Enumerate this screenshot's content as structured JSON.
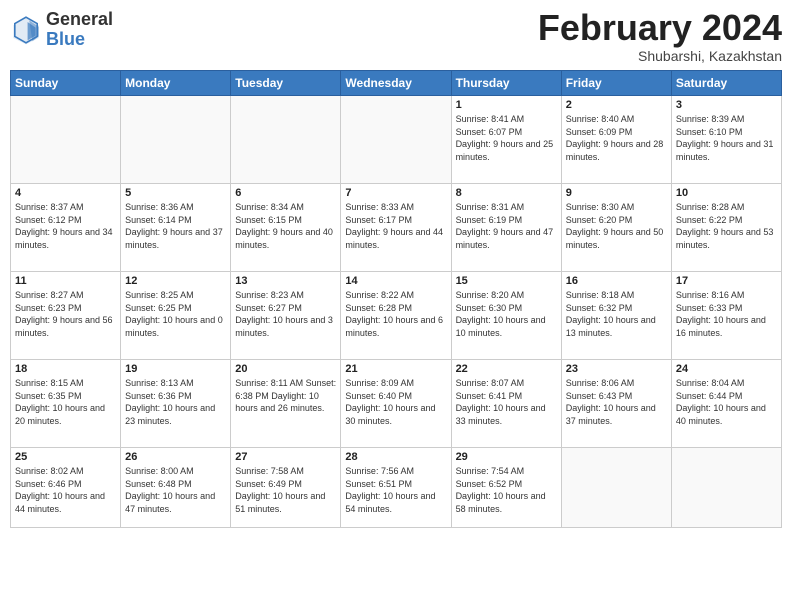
{
  "logo": {
    "line1": "General",
    "line2": "Blue"
  },
  "header": {
    "month": "February 2024",
    "location": "Shubarshi, Kazakhstan"
  },
  "days_of_week": [
    "Sunday",
    "Monday",
    "Tuesday",
    "Wednesday",
    "Thursday",
    "Friday",
    "Saturday"
  ],
  "weeks": [
    [
      {
        "day": "",
        "info": ""
      },
      {
        "day": "",
        "info": ""
      },
      {
        "day": "",
        "info": ""
      },
      {
        "day": "",
        "info": ""
      },
      {
        "day": "1",
        "info": "Sunrise: 8:41 AM\nSunset: 6:07 PM\nDaylight: 9 hours and 25 minutes."
      },
      {
        "day": "2",
        "info": "Sunrise: 8:40 AM\nSunset: 6:09 PM\nDaylight: 9 hours and 28 minutes."
      },
      {
        "day": "3",
        "info": "Sunrise: 8:39 AM\nSunset: 6:10 PM\nDaylight: 9 hours and 31 minutes."
      }
    ],
    [
      {
        "day": "4",
        "info": "Sunrise: 8:37 AM\nSunset: 6:12 PM\nDaylight: 9 hours and 34 minutes."
      },
      {
        "day": "5",
        "info": "Sunrise: 8:36 AM\nSunset: 6:14 PM\nDaylight: 9 hours and 37 minutes."
      },
      {
        "day": "6",
        "info": "Sunrise: 8:34 AM\nSunset: 6:15 PM\nDaylight: 9 hours and 40 minutes."
      },
      {
        "day": "7",
        "info": "Sunrise: 8:33 AM\nSunset: 6:17 PM\nDaylight: 9 hours and 44 minutes."
      },
      {
        "day": "8",
        "info": "Sunrise: 8:31 AM\nSunset: 6:19 PM\nDaylight: 9 hours and 47 minutes."
      },
      {
        "day": "9",
        "info": "Sunrise: 8:30 AM\nSunset: 6:20 PM\nDaylight: 9 hours and 50 minutes."
      },
      {
        "day": "10",
        "info": "Sunrise: 8:28 AM\nSunset: 6:22 PM\nDaylight: 9 hours and 53 minutes."
      }
    ],
    [
      {
        "day": "11",
        "info": "Sunrise: 8:27 AM\nSunset: 6:23 PM\nDaylight: 9 hours and 56 minutes."
      },
      {
        "day": "12",
        "info": "Sunrise: 8:25 AM\nSunset: 6:25 PM\nDaylight: 10 hours and 0 minutes."
      },
      {
        "day": "13",
        "info": "Sunrise: 8:23 AM\nSunset: 6:27 PM\nDaylight: 10 hours and 3 minutes."
      },
      {
        "day": "14",
        "info": "Sunrise: 8:22 AM\nSunset: 6:28 PM\nDaylight: 10 hours and 6 minutes."
      },
      {
        "day": "15",
        "info": "Sunrise: 8:20 AM\nSunset: 6:30 PM\nDaylight: 10 hours and 10 minutes."
      },
      {
        "day": "16",
        "info": "Sunrise: 8:18 AM\nSunset: 6:32 PM\nDaylight: 10 hours and 13 minutes."
      },
      {
        "day": "17",
        "info": "Sunrise: 8:16 AM\nSunset: 6:33 PM\nDaylight: 10 hours and 16 minutes."
      }
    ],
    [
      {
        "day": "18",
        "info": "Sunrise: 8:15 AM\nSunset: 6:35 PM\nDaylight: 10 hours and 20 minutes."
      },
      {
        "day": "19",
        "info": "Sunrise: 8:13 AM\nSunset: 6:36 PM\nDaylight: 10 hours and 23 minutes."
      },
      {
        "day": "20",
        "info": "Sunrise: 8:11 AM\nSunset: 6:38 PM\nDaylight: 10 hours and 26 minutes."
      },
      {
        "day": "21",
        "info": "Sunrise: 8:09 AM\nSunset: 6:40 PM\nDaylight: 10 hours and 30 minutes."
      },
      {
        "day": "22",
        "info": "Sunrise: 8:07 AM\nSunset: 6:41 PM\nDaylight: 10 hours and 33 minutes."
      },
      {
        "day": "23",
        "info": "Sunrise: 8:06 AM\nSunset: 6:43 PM\nDaylight: 10 hours and 37 minutes."
      },
      {
        "day": "24",
        "info": "Sunrise: 8:04 AM\nSunset: 6:44 PM\nDaylight: 10 hours and 40 minutes."
      }
    ],
    [
      {
        "day": "25",
        "info": "Sunrise: 8:02 AM\nSunset: 6:46 PM\nDaylight: 10 hours and 44 minutes."
      },
      {
        "day": "26",
        "info": "Sunrise: 8:00 AM\nSunset: 6:48 PM\nDaylight: 10 hours and 47 minutes."
      },
      {
        "day": "27",
        "info": "Sunrise: 7:58 AM\nSunset: 6:49 PM\nDaylight: 10 hours and 51 minutes."
      },
      {
        "day": "28",
        "info": "Sunrise: 7:56 AM\nSunset: 6:51 PM\nDaylight: 10 hours and 54 minutes."
      },
      {
        "day": "29",
        "info": "Sunrise: 7:54 AM\nSunset: 6:52 PM\nDaylight: 10 hours and 58 minutes."
      },
      {
        "day": "",
        "info": ""
      },
      {
        "day": "",
        "info": ""
      }
    ]
  ]
}
